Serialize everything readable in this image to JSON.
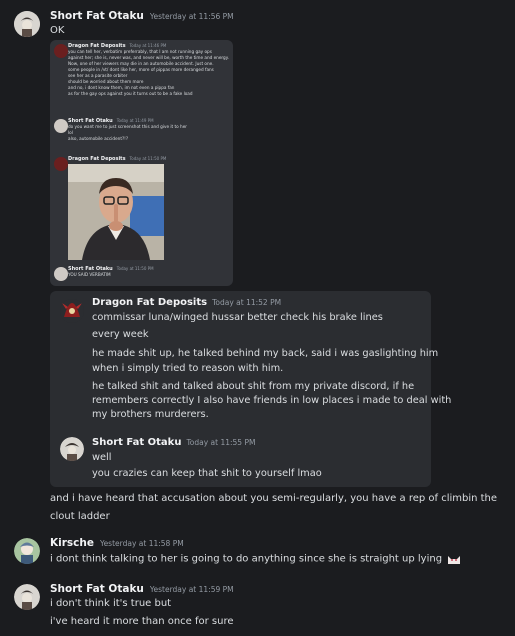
{
  "messages": [
    {
      "user": "Short Fat Otaku",
      "timestamp": "Yesterday at 11:56 PM",
      "lines": [
        "OK"
      ]
    },
    {
      "lines": [
        "and i have heard that accusation about you semi-regularly, you have a rep of climbin the",
        "clout ladder"
      ]
    },
    {
      "user": "Kirsche",
      "timestamp": "Yesterday at 11:58 PM",
      "lines": [
        "i dont think talking to her is going to do anything since she is straight up lying"
      ]
    },
    {
      "user": "Short Fat Otaku",
      "timestamp": "Yesterday at 11:59 PM",
      "lines": [
        "i don't think it's true but",
        "i've heard it more than once for sure"
      ]
    }
  ],
  "screenshot": {
    "posts": [
      {
        "user": "Dragon Fat Deposits",
        "timestamp": "Today at 11:46 PM",
        "lines": [
          "you can tell her, verbatim preferrably, that I am not running gay ops",
          "against her; she is, never was, and never will be, worth the time and energy.",
          "Now, one of her viewers may die in an automobile accident. Just one.",
          "some people in /vt/ dont like her, more of pippas more deranged fans",
          "see her as a parasite orbiter",
          "should be worried about them more",
          "and no, i dont know them, im not even a pippa fan",
          "as for the gay ops against you it turns out to be a fake load"
        ]
      },
      {
        "user": "Short Fat Otaku",
        "timestamp": "Today at 11:49 PM",
        "lines": [
          "do you want me to just screenshot this and give it to her",
          "lol",
          "also, automobile accident?!?"
        ]
      },
      {
        "user": "Dragon Fat Deposits",
        "timestamp": "Today at 11:50 PM",
        "lines": []
      },
      {
        "user": "Short Fat Otaku",
        "timestamp": "Today at 11:50 PM",
        "lines": [
          "YOU SAID VERBATIM"
        ]
      }
    ]
  },
  "quote": {
    "user": "Dragon Fat Deposits",
    "timestamp": "Today at 11:52 PM",
    "lines": [
      "commissar luna/winged hussar better check his brake lines",
      "every week",
      "he made shit up, he talked behind my back, said i was gaslighting him",
      "when i simply tried to reason with him.",
      "he talked shit and talked about shit from my private discord, if he",
      "remembers correctly I also have friends in low places i made to deal with",
      "my brothers murderers."
    ],
    "reply": {
      "user": "Short Fat Otaku",
      "timestamp": "Today at 11:55 PM",
      "lines": [
        "well",
        "you crazies can keep that shit to yourself lmao"
      ]
    }
  }
}
